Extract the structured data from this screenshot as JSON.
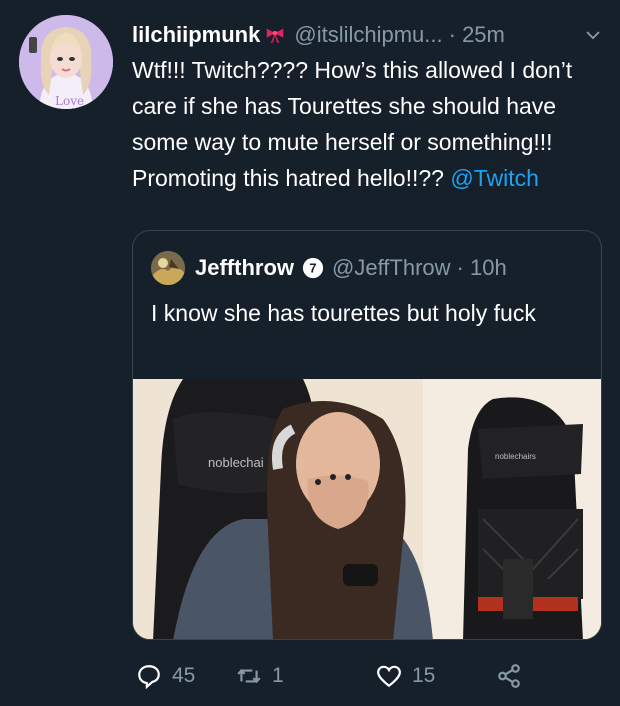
{
  "tweet": {
    "display_name": "lilchiipmunk",
    "handle": "@itslilchipmu...",
    "time": "· 25m",
    "text_main": "Wtf!!! Twitch???? How’s this allowed I don’t care if she has Tourettes she should have some way to mute herself or something!!! Promoting this hatred hello!!?? ",
    "mention": "@Twitch"
  },
  "quoted": {
    "display_name": "Jeffthrow",
    "handle": "@JeffThrow",
    "time": "· 10h",
    "text": "I know she has tourettes but holy fuck",
    "verified_badge": "7",
    "media": {
      "chair_left_brand": "noblechai",
      "chair_right_brand": "noblechairs"
    }
  },
  "actions": {
    "reply_count": "45",
    "retweet_count": "1",
    "like_count": "15"
  },
  "icons": {
    "bow": "bow-icon",
    "chevron": "chevron-down-icon",
    "reply": "reply-icon",
    "retweet": "retweet-icon",
    "like": "heart-icon",
    "share": "share-icon"
  },
  "colors": {
    "background": "#15202b",
    "secondary_text": "#8899a6",
    "mention": "#1da1f2",
    "border": "#38444d"
  }
}
